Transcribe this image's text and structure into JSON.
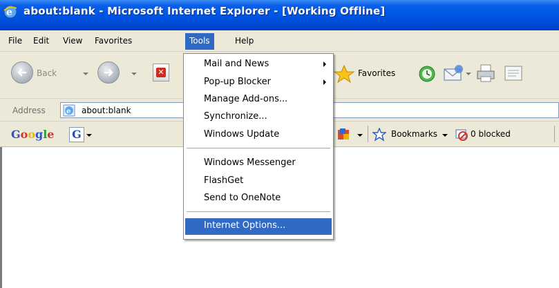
{
  "window": {
    "title": "about:blank - Microsoft Internet Explorer - [Working Offline]"
  },
  "menubar": {
    "items": [
      "File",
      "Edit",
      "View",
      "Favorites",
      "Tools",
      "Help"
    ],
    "active": "Tools"
  },
  "toolbar": {
    "back_label": "Back",
    "favorites_label": "Favorites"
  },
  "address": {
    "label": "Address",
    "value": "about:blank"
  },
  "google_toolbar": {
    "logo": "Google",
    "g_button": "G",
    "bookmarks_label": "Bookmarks",
    "blocked_label": "0 blocked"
  },
  "tools_menu": {
    "items": [
      {
        "label": "Mail and News",
        "submenu": true
      },
      {
        "label": "Pop-up Blocker",
        "submenu": true
      },
      {
        "label": "Manage Add-ons...",
        "submenu": false
      },
      {
        "label": "Synchronize...",
        "submenu": false
      },
      {
        "label": "Windows Update",
        "submenu": false
      },
      {
        "label": "Windows Messenger",
        "submenu": false
      },
      {
        "label": "FlashGet",
        "submenu": false
      },
      {
        "label": "Send to OneNote",
        "submenu": false
      },
      {
        "label": "Internet Options...",
        "submenu": false,
        "highlighted": true
      }
    ]
  },
  "colors": {
    "titlebar": "#0055e3",
    "menu_highlight": "#316ac5",
    "chrome": "#ece9d8"
  }
}
